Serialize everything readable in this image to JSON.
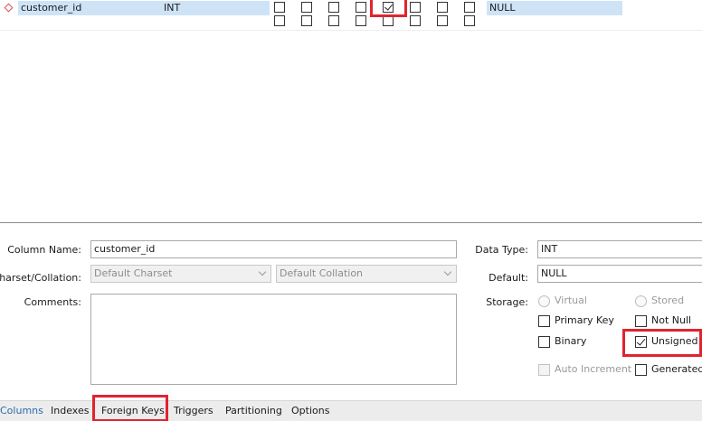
{
  "grid": {
    "rows": [
      {
        "name": "customer_id",
        "type": "INT",
        "flags": [
          false,
          false,
          false,
          false,
          true,
          false,
          false,
          false
        ],
        "default": "NULL"
      },
      {
        "name": "",
        "type": "",
        "flags": [
          false,
          false,
          false,
          false,
          false,
          false,
          false,
          false
        ],
        "default": ""
      }
    ]
  },
  "editor": {
    "column_name_label": "Column Name:",
    "column_name_value": "customer_id",
    "charset_label": "Charset/Collation:",
    "charset_value": "Default Charset",
    "collation_value": "Default Collation",
    "comments_label": "Comments:",
    "comments_value": "",
    "data_type_label": "Data Type:",
    "data_type_value": "INT",
    "default_label": "Default:",
    "default_value": "NULL",
    "storage_label": "Storage:",
    "storage": {
      "virtual": "Virtual",
      "stored": "Stored"
    },
    "options": {
      "primary_key": "Primary Key",
      "not_null": "Not Null",
      "binary": "Binary",
      "unsigned": "Unsigned",
      "auto_increment": "Auto Increment",
      "generated": "Generated"
    },
    "option_states": {
      "primary_key": false,
      "not_null": false,
      "binary": false,
      "unsigned": true,
      "auto_increment": false,
      "generated": false
    }
  },
  "tabs": [
    "Columns",
    "Indexes",
    "Foreign Keys",
    "Triggers",
    "Partitioning",
    "Options"
  ],
  "active_tab": "Columns",
  "colors": {
    "row_highlight": "#cfe3f7",
    "annotation_red": "#e0242f",
    "active_tab": "#2b6cb0"
  }
}
